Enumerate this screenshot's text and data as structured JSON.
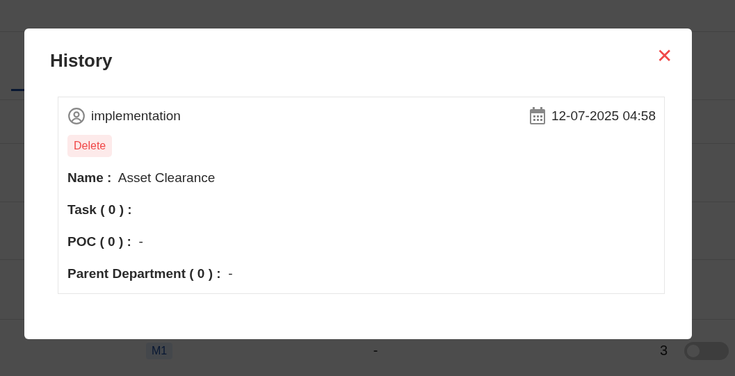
{
  "background": {
    "rows": [
      {
        "badge": "M1",
        "column_2": "-",
        "column_3": "3",
        "toggle_on": false
      }
    ]
  },
  "modal": {
    "title": "History",
    "close": "✕",
    "entries": [
      {
        "user": "implementation",
        "datetime": "12-07-2025 04:58",
        "action": "Delete",
        "fields": [
          "**Name :**  Asset Clearance",
          "**Task ( 0 ) :**",
          "**POC ( 0 ) :**  -",
          "**Parent Department ( 0 ) :**  -"
        ]
      }
    ]
  }
}
